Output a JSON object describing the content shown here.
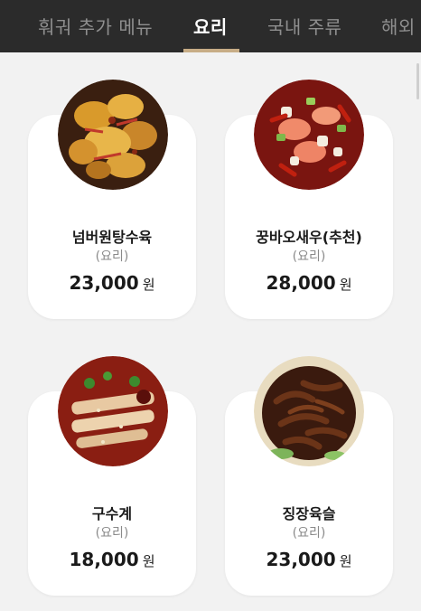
{
  "tabs": [
    {
      "label": "훠궈 추가 메뉴",
      "active": false
    },
    {
      "label": "요리",
      "active": true
    },
    {
      "label": "국내 주류",
      "active": false
    },
    {
      "label": "해외",
      "active": false
    }
  ],
  "colors": {
    "topbar": "#2b2b2b",
    "active_underline": "#c8ad86",
    "background": "#f2f2f2"
  },
  "items": [
    {
      "name": "넘버원탕수육",
      "category": "(요리)",
      "price": "23,000",
      "unit": "원",
      "image": "sweet-sour-pork-image"
    },
    {
      "name": "꿍바오새우(추천)",
      "category": "(요리)",
      "price": "28,000",
      "unit": "원",
      "image": "kung-pao-shrimp-image"
    },
    {
      "name": "구수계",
      "category": "(요리)",
      "price": "18,000",
      "unit": "원",
      "image": "mouthwatering-chicken-image"
    },
    {
      "name": "징장육슬",
      "category": "(요리)",
      "price": "23,000",
      "unit": "원",
      "image": "shredded-pork-image"
    }
  ]
}
